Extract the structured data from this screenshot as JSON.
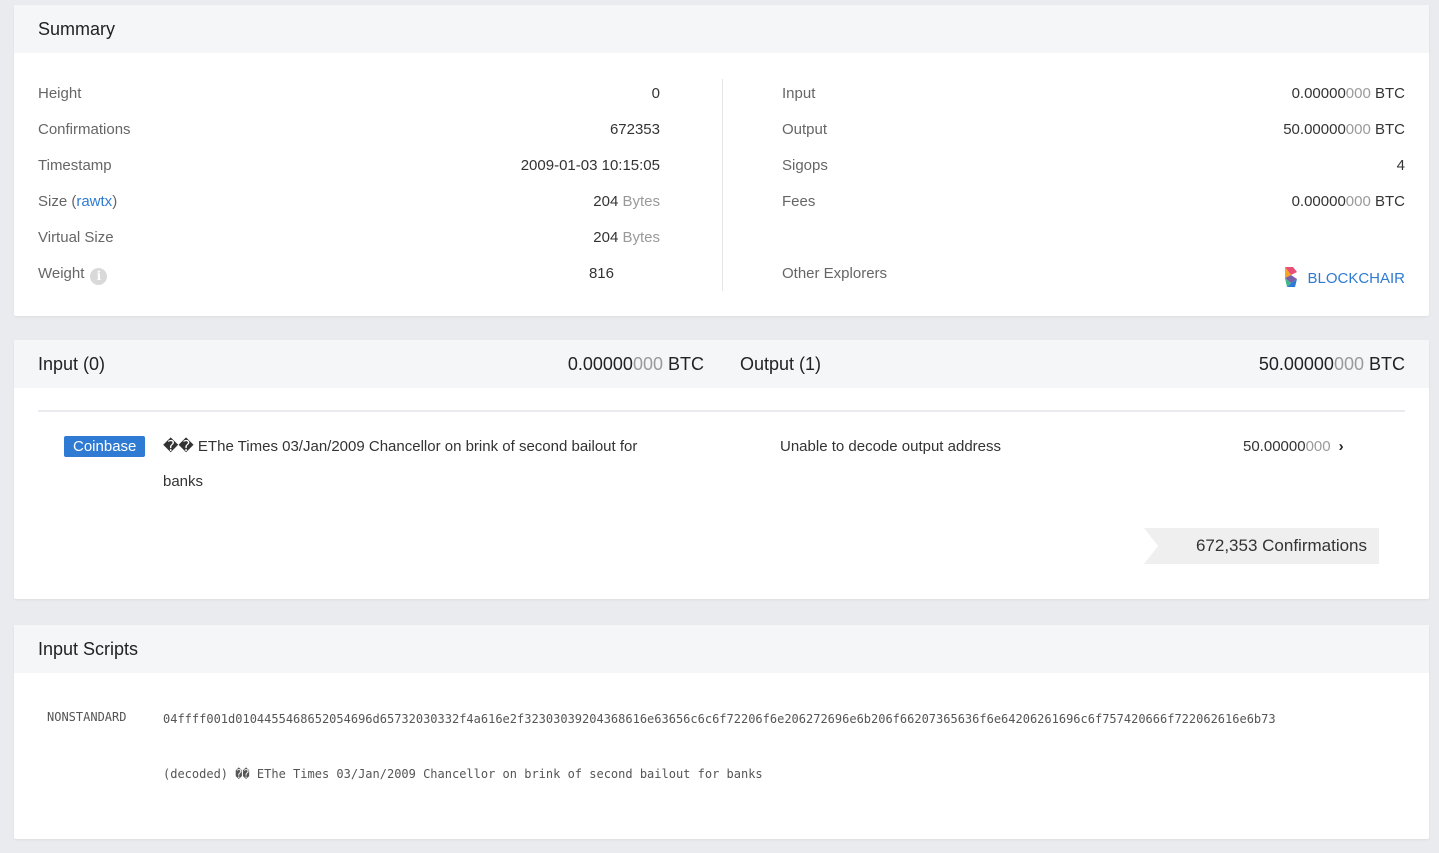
{
  "summary": {
    "title": "Summary",
    "left": [
      {
        "label": "Height",
        "value": "0"
      },
      {
        "label": "Confirmations",
        "value": "672353"
      },
      {
        "label": "Timestamp",
        "value": "2009-01-03 10:15:05"
      },
      {
        "label": "Size (",
        "label_link": "rawtx",
        "label_end": ")",
        "value_num": "204",
        "value_unit": "Bytes"
      },
      {
        "label": "Virtual Size",
        "value_num": "204",
        "value_unit": "Bytes"
      },
      {
        "label": "Weight",
        "value": "816"
      }
    ],
    "right": [
      {
        "label": "Input",
        "value_bold": "0.00000",
        "value_dim": "000",
        "value_unit": "BTC"
      },
      {
        "label": "Output",
        "value_bold": "50.00000",
        "value_dim": "000",
        "value_unit": "BTC"
      },
      {
        "label": "Sigops",
        "value": "4"
      },
      {
        "label": "Fees",
        "value_bold": "0.00000",
        "value_dim": "000",
        "value_unit": "BTC"
      },
      {
        "label": "Other Explorers",
        "value": "BLOCKCHAIR"
      }
    ],
    "info_icon": "info-icon",
    "info_glyph": "i"
  },
  "io": {
    "input_title": "Input (0)",
    "input_total_bold": "0.00000",
    "input_total_dim": "000",
    "input_unit": "BTC",
    "output_title": "Output (1)",
    "output_total_bold": "50.00000",
    "output_total_dim": "000",
    "output_unit": "BTC",
    "coinbase_badge": "Coinbase",
    "coinbase_text": "�� EThe Times 03/Jan/2009 Chancellor on brink of second bailout for banks",
    "output_address": "Unable to decode output address",
    "output_value_bold": "50.00000",
    "output_value_dim": "000",
    "chevron": "›",
    "confirmations": "672,353 Confirmations"
  },
  "scripts": {
    "title": "Input Scripts",
    "type": "NONSTANDARD",
    "hex": "04ffff001d0104455468652054696d65732030332f4a616e2f32303039204368616e63656c6c6f72206f6e206272696e6b206f66207365636f6e64206261696c6f757420666f722062616e6b73",
    "decoded": "(decoded) �� EThe Times 03/Jan/2009 Chancellor on brink of second bailout for banks"
  },
  "colors": {
    "accent": "#2f7bd3",
    "background": "#e9ebee",
    "header": "#f5f6f7"
  }
}
